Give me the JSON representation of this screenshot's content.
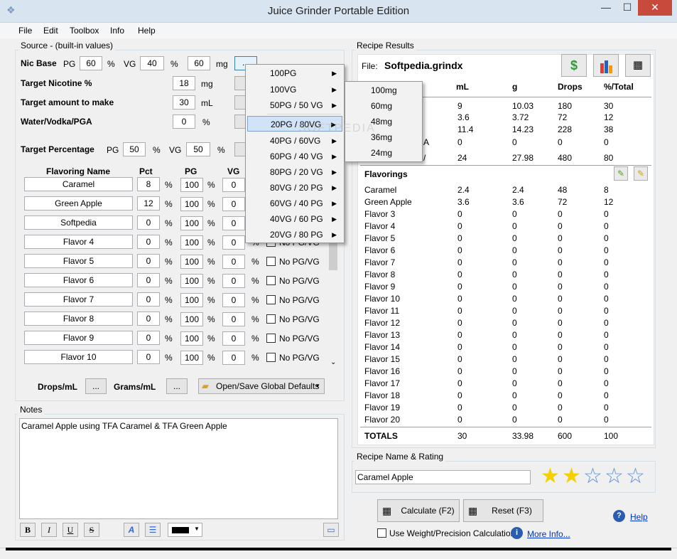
{
  "window": {
    "title": "Juice Grinder Portable Edition",
    "minimize": "—",
    "maximize": "☐",
    "close": "✕"
  },
  "menu": [
    "File",
    "Edit",
    "Toolbox",
    "Info",
    "Help"
  ],
  "source": {
    "label": "Source - (built-in values)",
    "nic_base": {
      "label": "Nic Base",
      "pg_label": "PG",
      "pg": "60",
      "pct1": "%",
      "vg_label": "VG",
      "vg": "40",
      "pct2": "%",
      "mg": "60",
      "mg_unit": "mg",
      "btn": "..."
    },
    "target_nicotine": {
      "label": "Target Nicotine %",
      "value": "18",
      "unit": "mg"
    },
    "target_amount": {
      "label": "Target amount to make",
      "value": "30",
      "unit": "mL"
    },
    "water": {
      "label": "Water/Vodka/PGA",
      "value": "0",
      "unit": "%"
    },
    "target_pct": {
      "label": "Target Percentage",
      "pg_label": "PG",
      "pg": "50",
      "pct1": "%",
      "vg_label": "VG",
      "vg": "50",
      "pct2": "%"
    }
  },
  "flavor_table": {
    "headers": {
      "name": "Flavoring Name",
      "pct": "Pct",
      "pg": "PG",
      "vg": "VG"
    },
    "unit": "%",
    "nopgvg": "No PG/VG",
    "rows": [
      {
        "name": "Caramel",
        "pct": "8",
        "pg": "100",
        "vg": "0"
      },
      {
        "name": "Green Apple",
        "pct": "12",
        "pg": "100",
        "vg": "0"
      },
      {
        "name": "Softpedia",
        "pct": "0",
        "pg": "100",
        "vg": "0"
      },
      {
        "name": "Flavor 4",
        "pct": "0",
        "pg": "100",
        "vg": "0"
      },
      {
        "name": "Flavor 5",
        "pct": "0",
        "pg": "100",
        "vg": "0"
      },
      {
        "name": "Flavor 6",
        "pct": "0",
        "pg": "100",
        "vg": "0"
      },
      {
        "name": "Flavor 7",
        "pct": "0",
        "pg": "100",
        "vg": "0"
      },
      {
        "name": "Flavor 8",
        "pct": "0",
        "pg": "100",
        "vg": "0"
      },
      {
        "name": "Flavor 9",
        "pct": "0",
        "pg": "100",
        "vg": "0"
      },
      {
        "name": "Flavor 10",
        "pct": "0",
        "pg": "100",
        "vg": "0"
      }
    ]
  },
  "bottom_controls": {
    "drops_label": "Drops/mL",
    "drops_btn": "...",
    "grams_label": "Grams/mL",
    "grams_btn": "...",
    "global": "Open/Save Global Defaults"
  },
  "notes": {
    "label": "Notes",
    "text": "Caramel Apple using TFA Caramel & TFA Green Apple",
    "color_value": ""
  },
  "popup1": [
    "100PG",
    "100VG",
    "50PG / 50 VG",
    "20PG / 80VG",
    "40PG / 60VG",
    "60PG / 40 VG",
    "80PG / 20 VG",
    "80VG / 20 PG",
    "60VG / 40 PG",
    "40VG / 60 PG",
    "20VG / 80 PG"
  ],
  "popup2": [
    "100mg",
    "60mg",
    "48mg",
    "36mg",
    "24mg"
  ],
  "results": {
    "label": "Recipe Results",
    "file_label": "File:",
    "file_name": "Softpedia.grindx",
    "headers": [
      "mL",
      "g",
      "Drops",
      "%/Total"
    ],
    "base_rows": [
      [
        "9",
        "10.03",
        "180",
        "30"
      ],
      [
        "3.6",
        "3.72",
        "72",
        "12"
      ],
      [
        "11.4",
        "14.23",
        "228",
        "38"
      ],
      [
        "0",
        "0",
        "0",
        "0"
      ],
      [
        "24",
        "27.98",
        "480",
        "80"
      ]
    ],
    "base_label_frags": [
      "A",
      "/"
    ],
    "flavorings_label": "Flavorings",
    "flavors": [
      [
        "Caramel",
        "2.4",
        "2.4",
        "48",
        "8"
      ],
      [
        "Green Apple",
        "3.6",
        "3.6",
        "72",
        "12"
      ],
      [
        "Flavor 3",
        "0",
        "0",
        "0",
        "0"
      ],
      [
        "Flavor 4",
        "0",
        "0",
        "0",
        "0"
      ],
      [
        "Flavor 5",
        "0",
        "0",
        "0",
        "0"
      ],
      [
        "Flavor 6",
        "0",
        "0",
        "0",
        "0"
      ],
      [
        "Flavor 7",
        "0",
        "0",
        "0",
        "0"
      ],
      [
        "Flavor 8",
        "0",
        "0",
        "0",
        "0"
      ],
      [
        "Flavor 9",
        "0",
        "0",
        "0",
        "0"
      ],
      [
        "Flavor 10",
        "0",
        "0",
        "0",
        "0"
      ],
      [
        "Flavor 11",
        "0",
        "0",
        "0",
        "0"
      ],
      [
        "Flavor 12",
        "0",
        "0",
        "0",
        "0"
      ],
      [
        "Flavor 13",
        "0",
        "0",
        "0",
        "0"
      ],
      [
        "Flavor 14",
        "0",
        "0",
        "0",
        "0"
      ],
      [
        "Flavor 15",
        "0",
        "0",
        "0",
        "0"
      ],
      [
        "Flavor 16",
        "0",
        "0",
        "0",
        "0"
      ],
      [
        "Flavor 17",
        "0",
        "0",
        "0",
        "0"
      ],
      [
        "Flavor 18",
        "0",
        "0",
        "0",
        "0"
      ],
      [
        "Flavor 19",
        "0",
        "0",
        "0",
        "0"
      ],
      [
        "Flavor 20",
        "0",
        "0",
        "0",
        "0"
      ]
    ],
    "totals": [
      "TOTALS",
      "30",
      "33.98",
      "600",
      "100"
    ]
  },
  "recipe_name": {
    "label": "Recipe Name & Rating",
    "value": "Caramel Apple",
    "rating": 2,
    "max": 5
  },
  "actions": {
    "calculate": "Calculate (F2)",
    "reset": "Reset (F3)",
    "help": "Help",
    "weight_label": "Use Weight/Precision Calculation",
    "more_info": "More Info..."
  },
  "watermark": "SOFTPEDIA",
  "colors": {
    "accent": "#3399ff",
    "star": "#f5d000",
    "close": "#c74a3c"
  }
}
